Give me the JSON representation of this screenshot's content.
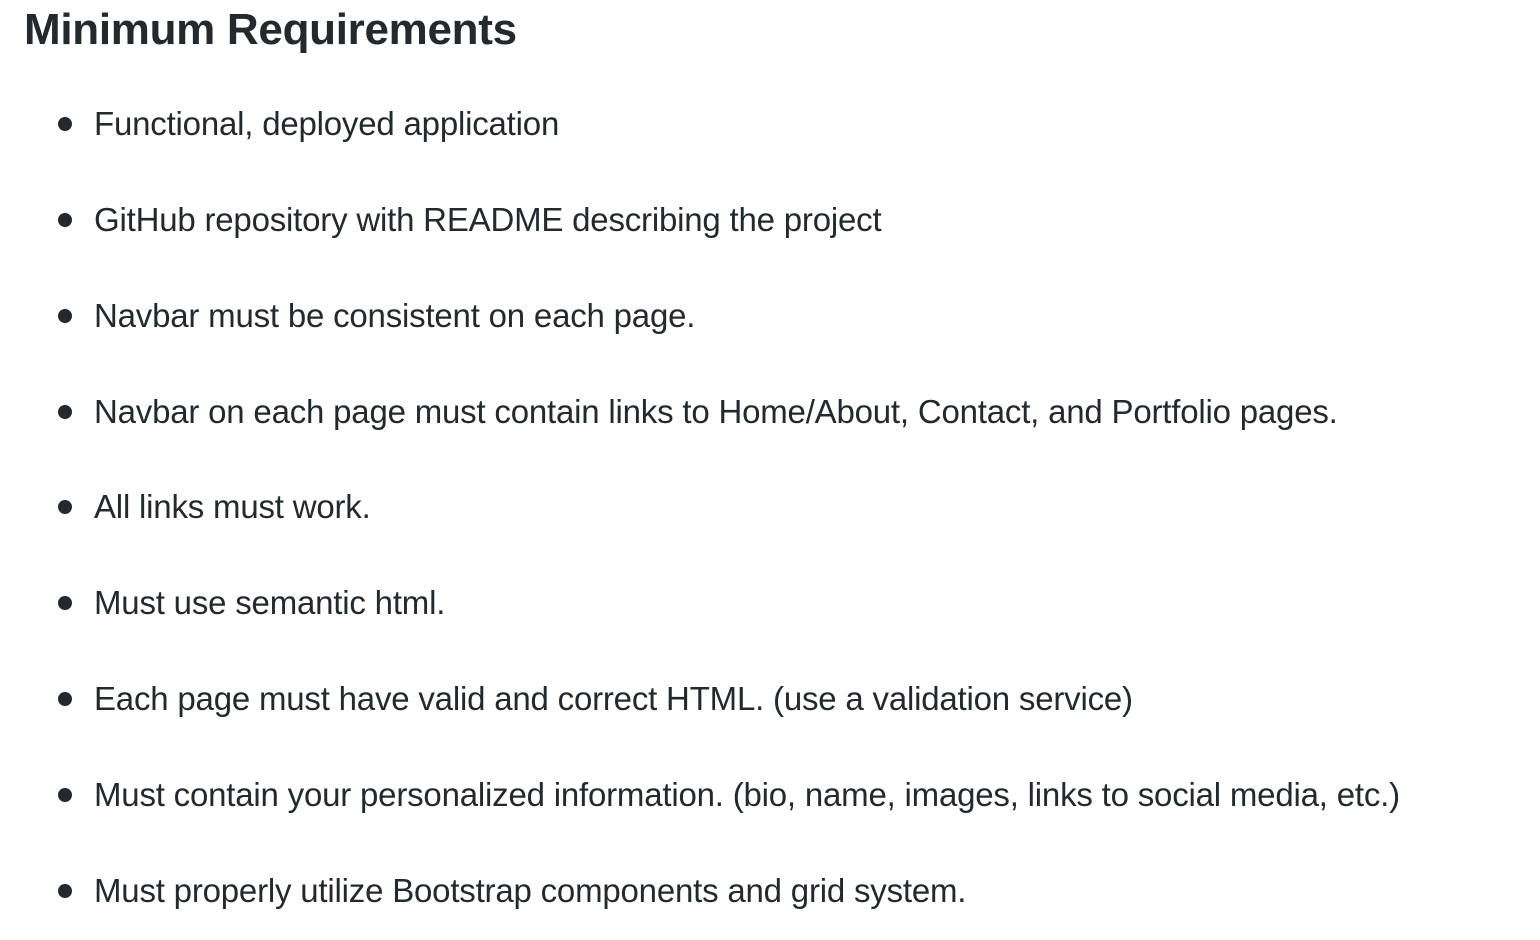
{
  "heading": {
    "title": "Minimum Requirements"
  },
  "requirements": [
    "Functional, deployed application",
    "GitHub repository with README describing the project",
    "Navbar must be consistent on each page.",
    "Navbar on each page must contain links to Home/About, Contact, and Portfolio pages.",
    "All links must work.",
    "Must use semantic html.",
    "Each page must have valid and correct HTML. (use a validation service)",
    "Must contain your personalized information. (bio, name, images, links to social media, etc.)",
    "Must properly utilize Bootstrap components and grid system."
  ],
  "icons": {
    "bullet": "bullet-dot-icon"
  }
}
